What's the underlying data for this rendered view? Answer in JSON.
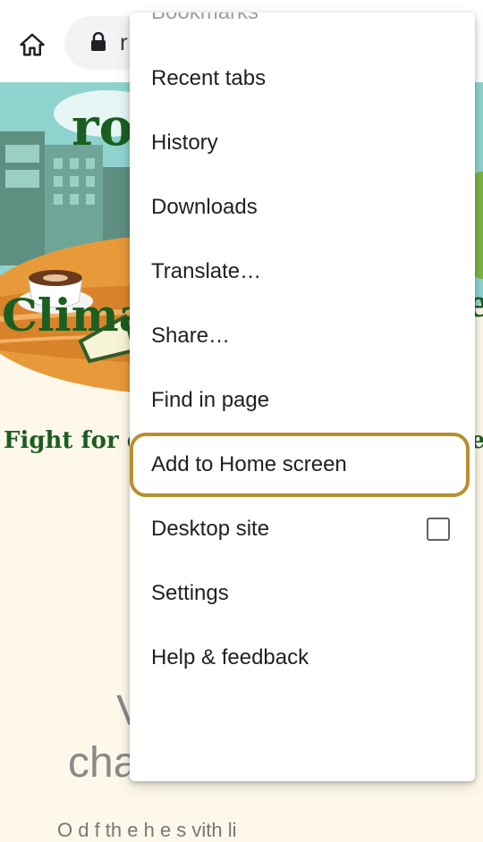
{
  "toolbar": {
    "url_fragment": "r"
  },
  "page": {
    "hero_title_fragment": "ro",
    "hero_subtitle_fragment": "Clima",
    "hero_subtitle_end": "e",
    "tagline_fragment": "Fight for cli",
    "tagline_end": "e",
    "big_w": "V",
    "big_cha": "cha",
    "bottom_faint": "O  d   f   th  e      h  e   s  vith  li"
  },
  "menu": {
    "items": [
      {
        "label": "Bookmarks"
      },
      {
        "label": "Recent tabs"
      },
      {
        "label": "History"
      },
      {
        "label": "Downloads"
      },
      {
        "label": "Translate…"
      },
      {
        "label": "Share…"
      },
      {
        "label": "Find in page"
      },
      {
        "label": "Add to Home screen"
      },
      {
        "label": "Desktop site",
        "checked": false
      },
      {
        "label": "Settings"
      },
      {
        "label": "Help & feedback"
      }
    ]
  },
  "colors": {
    "highlight": "#b8902e",
    "hero_green": "#1b5e20",
    "page_bg": "#fdf8ea"
  }
}
